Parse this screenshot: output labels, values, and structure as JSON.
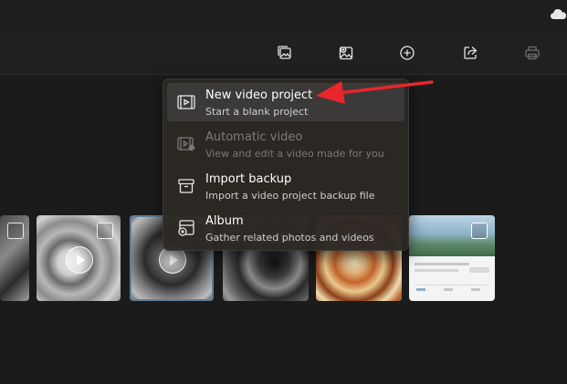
{
  "toolbar": {
    "buttons": [
      {
        "name": "slideshow-icon"
      },
      {
        "name": "add-to-album-icon"
      },
      {
        "name": "new-plus-icon"
      },
      {
        "name": "share-icon"
      },
      {
        "name": "print-icon"
      }
    ]
  },
  "menu": {
    "items": [
      {
        "title": "New video project",
        "subtitle": "Start a blank project",
        "enabled": true,
        "icon": "video-project-icon"
      },
      {
        "title": "Automatic video",
        "subtitle": "View and edit a video made for you",
        "enabled": false,
        "icon": "automatic-video-icon"
      },
      {
        "title": "Import backup",
        "subtitle": "Import a video project backup file",
        "enabled": true,
        "icon": "archive-icon"
      },
      {
        "title": "Album",
        "subtitle": "Gather related photos and videos",
        "enabled": true,
        "icon": "album-icon"
      }
    ]
  },
  "gallery": {
    "items": [
      {
        "type": "photo"
      },
      {
        "type": "video"
      },
      {
        "type": "video",
        "selected": true
      },
      {
        "type": "photo"
      },
      {
        "type": "photo"
      },
      {
        "type": "screenshot"
      }
    ]
  },
  "colors": {
    "annotation_arrow": "#e8262b",
    "background": "#1b1b1b",
    "menu_background": "#2c2824"
  }
}
